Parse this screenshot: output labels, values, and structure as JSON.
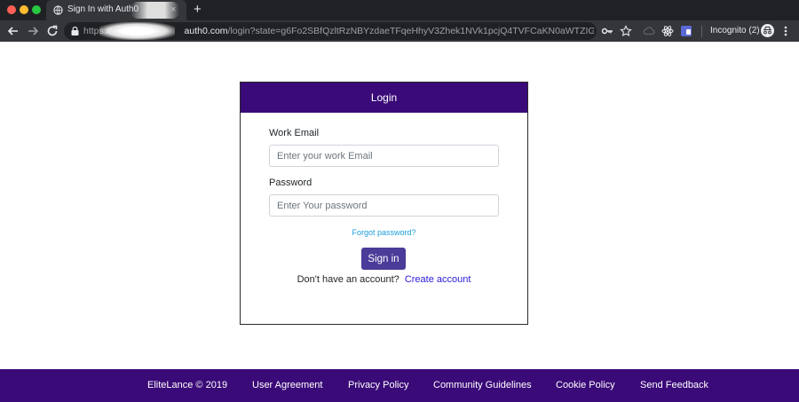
{
  "browser": {
    "tab_title": "Sign In with Auth0",
    "tab_close": "×",
    "new_tab": "+",
    "url_prefix": "https://",
    "url_host": "auth0.com",
    "url_path": "/login?state=g6Fo2SBfQzltRzNBYzdaeTFqeHhyV3Zhek1NVk1pcjQ4TVFCaKN0aWTZIG5GaDNHSW...",
    "incognito_label": "Incognito (2)"
  },
  "login": {
    "header": "Login",
    "email_label": "Work Email",
    "email_placeholder": "Enter your work Email",
    "password_label": "Password",
    "password_placeholder": "Enter Your password",
    "forgot_link": "Forgot password?",
    "signin_button": "Sign in",
    "no_account_text": "Don't have an account?",
    "create_account_link": "Create account"
  },
  "footer": {
    "copyright": "EliteLance © 2019",
    "links": [
      "User Agreement",
      "Privacy Policy",
      "Community Guidelines",
      "Cookie Policy",
      "Send Feedback"
    ]
  },
  "colors": {
    "brand": "#3a0a78",
    "button": "#4a3c98",
    "link": "#1a9dd9",
    "create_link": "#2c1ad9"
  }
}
